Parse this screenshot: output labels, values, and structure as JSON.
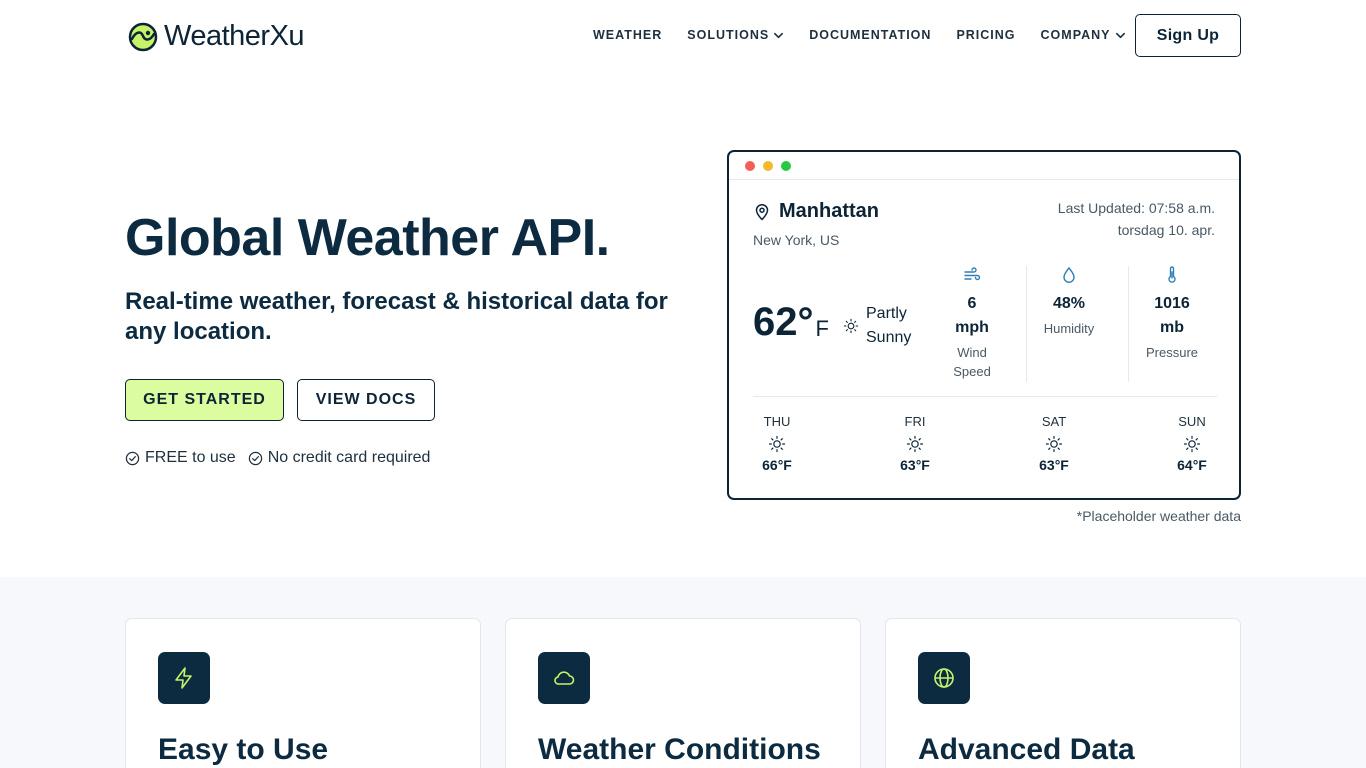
{
  "header": {
    "brand": "WeatherXu",
    "nav": [
      {
        "label": "WEATHER",
        "has_dropdown": false
      },
      {
        "label": "SOLUTIONS",
        "has_dropdown": true
      },
      {
        "label": "DOCUMENTATION",
        "has_dropdown": false
      },
      {
        "label": "PRICING",
        "has_dropdown": false
      },
      {
        "label": "COMPANY",
        "has_dropdown": true
      }
    ],
    "signup_label": "Sign Up"
  },
  "hero": {
    "title": "Global Weather API.",
    "subtitle": "Real-time weather, forecast & historical data for any location.",
    "primary_cta": "GET STARTED",
    "secondary_cta": "VIEW DOCS",
    "perks": [
      "FREE to use",
      "No credit card required"
    ]
  },
  "weather_card": {
    "city": "Manhattan",
    "region": "New York, US",
    "updated_line1": "Last Updated: 07:58 a.m.",
    "updated_line2": "torsdag 10. apr.",
    "temperature": "62°",
    "temperature_unit": "F",
    "condition_line1": "Partly",
    "condition_line2": "Sunny",
    "wind_value_line1": "6",
    "wind_value_line2": "mph",
    "wind_label_line1": "Wind",
    "wind_label_line2": "Speed",
    "humidity_value": "48%",
    "humidity_label": "Humidity",
    "pressure_value_line1": "1016",
    "pressure_value_line2": "mb",
    "pressure_label": "Pressure",
    "forecast": [
      {
        "day": "THU",
        "temp": "66°F",
        "icon": "sun-icon"
      },
      {
        "day": "FRI",
        "temp": "63°F",
        "icon": "sun-icon"
      },
      {
        "day": "SAT",
        "temp": "63°F",
        "icon": "sun-icon"
      },
      {
        "day": "SUN",
        "temp": "64°F",
        "icon": "sun-icon"
      }
    ],
    "note": "*Placeholder weather data"
  },
  "features": [
    {
      "title": "Easy to Use",
      "icon": "lightning-icon"
    },
    {
      "title": "Weather Conditions",
      "icon": "cloud-icon"
    },
    {
      "title": "Advanced Data",
      "icon": "globe-icon"
    }
  ],
  "colors": {
    "navy": "#0c2436",
    "accent_green": "#dcfca0",
    "logo_green": "#c6f36a",
    "window_red": "#f25f57",
    "window_yellow": "#f5b92e",
    "window_green": "#2ac840",
    "icon_blue": "#2f7fb5",
    "section_bg": "#f7f8fc"
  }
}
